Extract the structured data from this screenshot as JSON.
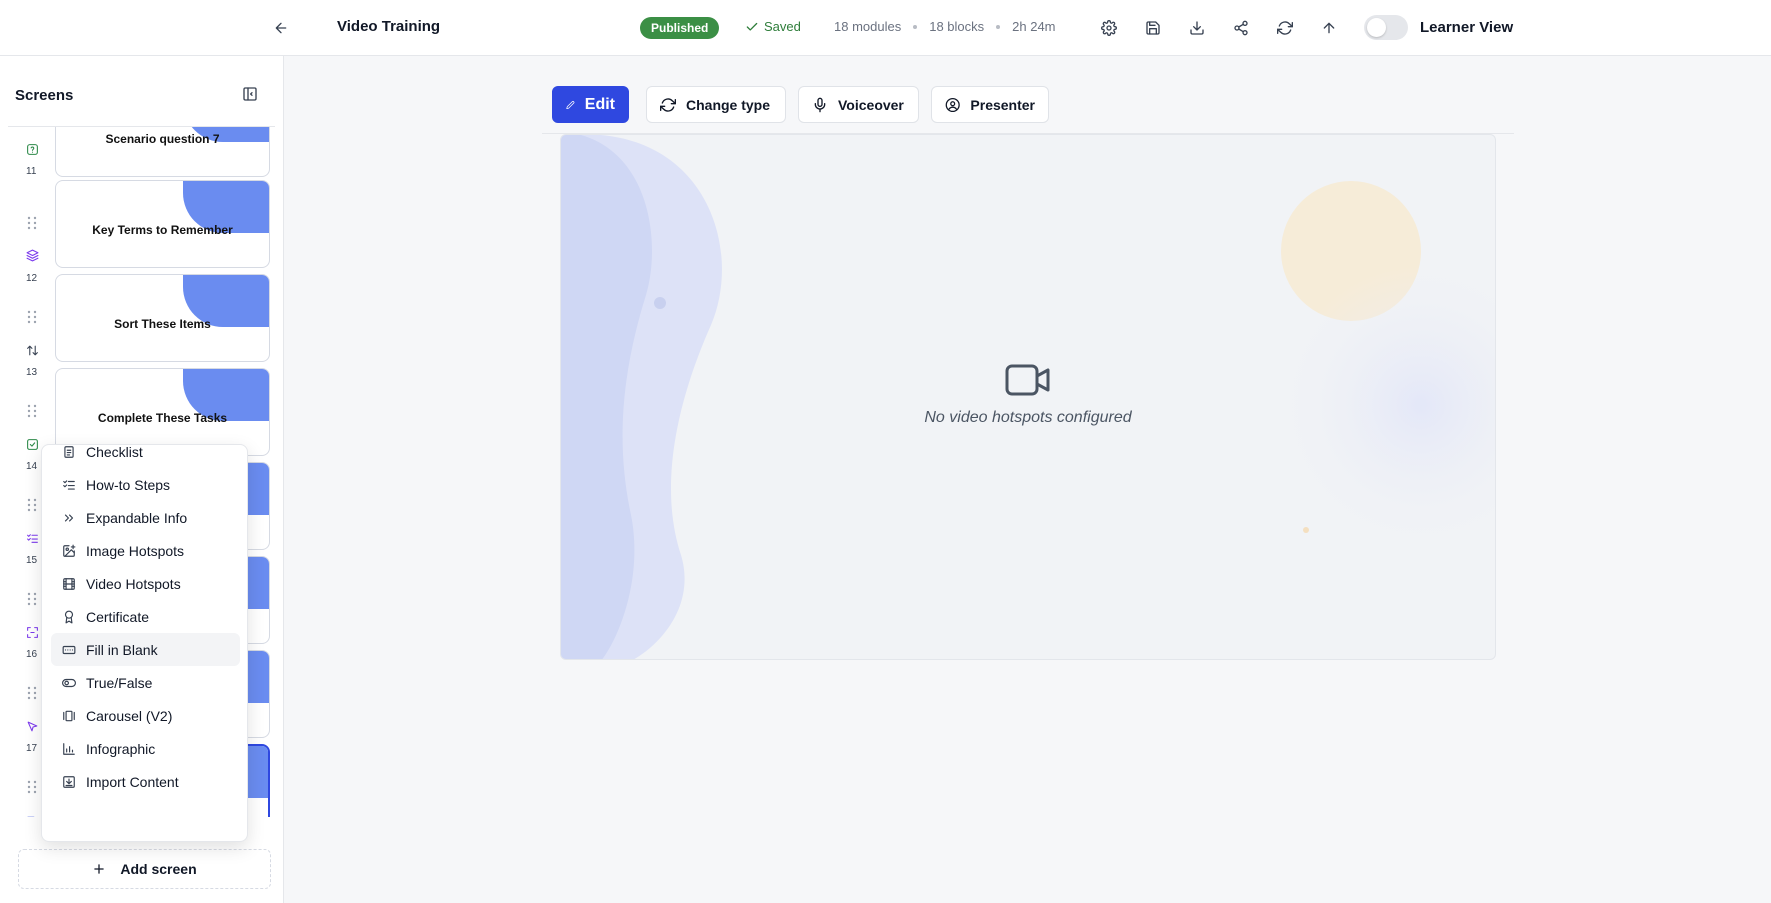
{
  "header": {
    "title": "Video Training",
    "status_badge": "Published",
    "saved_label": "Saved",
    "modules": "18 modules",
    "blocks": "18 blocks",
    "duration": "2h 24m",
    "learner_view_label": "Learner View"
  },
  "sidebar": {
    "title": "Screens",
    "screens": [
      {
        "number": "",
        "title": "Scenario question 7",
        "icon": "help-circle-icon",
        "selected": false
      },
      {
        "number": "11",
        "title": "Key Terms to Remember",
        "icon": "layers-icon",
        "selected": false
      },
      {
        "number": "12",
        "title": "Sort These Items",
        "icon": "sort-arrows-icon",
        "selected": false
      },
      {
        "number": "13",
        "title": "Complete These Tasks",
        "icon": "checkbox-icon",
        "selected": false
      },
      {
        "number": "14",
        "title": "",
        "icon": "list-checks-icon",
        "selected": false
      },
      {
        "number": "15",
        "title": "",
        "icon": "expand-icon",
        "selected": false
      },
      {
        "number": "16",
        "title": "",
        "icon": "pointer-icon",
        "selected": false
      },
      {
        "number": "17",
        "title": "",
        "icon": "video-icon",
        "selected": true
      }
    ],
    "add_screen_label": "Add screen"
  },
  "dropdown": {
    "items": [
      {
        "label": "Checklist",
        "icon": "clipboard-list-icon"
      },
      {
        "label": "How-to Steps",
        "icon": "list-checks-icon"
      },
      {
        "label": "Expandable Info",
        "icon": "chevrons-right-icon"
      },
      {
        "label": "Image Hotspots",
        "icon": "image-plus-icon"
      },
      {
        "label": "Video Hotspots",
        "icon": "film-icon"
      },
      {
        "label": "Certificate",
        "icon": "award-icon"
      },
      {
        "label": "Fill in Blank",
        "icon": "input-field-icon"
      },
      {
        "label": "True/False",
        "icon": "toggle-icon"
      },
      {
        "label": "Carousel (V2)",
        "icon": "carousel-icon"
      },
      {
        "label": "Infographic",
        "icon": "bar-chart-icon"
      },
      {
        "label": "Import Content",
        "icon": "import-icon"
      }
    ],
    "hovered_item": "Fill in Blank"
  },
  "toolbar": {
    "edit_label": "Edit",
    "change_type_label": "Change type",
    "voiceover_label": "Voiceover",
    "presenter_label": "Presenter"
  },
  "canvas": {
    "empty_message": "No video hotspots configured"
  },
  "colors": {
    "primary": "#2f48e0",
    "published": "#3b8f45",
    "saved": "#2e7d3a",
    "thumb_accent": "#6a8cf0"
  }
}
